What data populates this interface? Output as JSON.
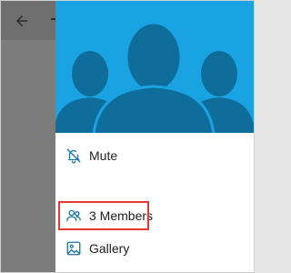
{
  "header": {
    "back_icon": "arrow-left-icon"
  },
  "drawer": {
    "hero_image": "group-silhouette-image",
    "hero_color": "#1aa3e2",
    "silhouette_color": "#0f6d9b",
    "items": [
      {
        "label": "Mute",
        "icon": "bell-off-icon"
      },
      {
        "label": "3 Members",
        "icon": "people-icon"
      },
      {
        "label": "Gallery",
        "icon": "image-icon"
      }
    ],
    "highlight_color": "#e53935"
  }
}
